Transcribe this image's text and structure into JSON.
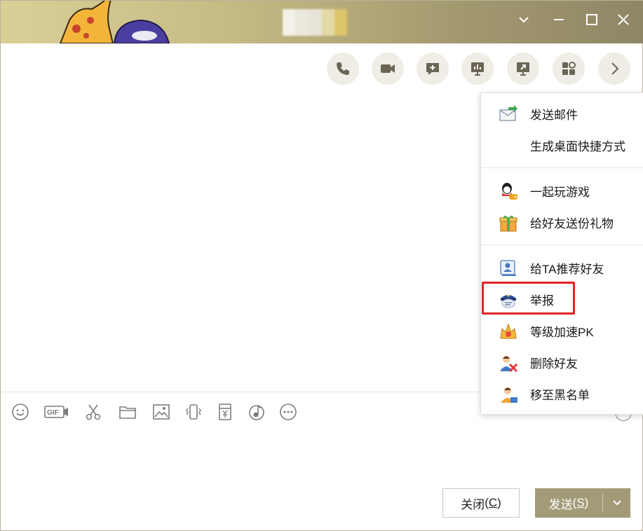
{
  "window": {
    "controls": [
      "chevron-down-icon",
      "minimize-icon",
      "maximize-icon",
      "close-icon"
    ]
  },
  "toolbar": {
    "buttons": [
      "phone-icon",
      "video-call-icon",
      "chat-bubble-plus-icon",
      "whiteboard-icon",
      "screen-share-icon",
      "apps-icon",
      "chevron-right-icon"
    ]
  },
  "input_toolbar": {
    "buttons": [
      "emoji-icon",
      "gif-icon",
      "scissors-icon",
      "folder-icon",
      "image-icon",
      "shake-icon",
      "red-packet-icon",
      "music-icon",
      "more-icon"
    ],
    "gif_text": "GIF"
  },
  "menu": {
    "items": [
      {
        "label": "发送邮件",
        "icon": "mail-icon"
      },
      {
        "label": "生成桌面快捷方式",
        "icon": ""
      },
      {
        "label": "一起玩游戏",
        "icon": "game-icon"
      },
      {
        "label": "给好友送份礼物",
        "icon": "gift-icon"
      },
      {
        "label": "给TA推荐好友",
        "icon": "recommend-contact-icon"
      },
      {
        "label": "举报",
        "icon": "police-report-icon"
      },
      {
        "label": "等级加速PK",
        "icon": "crown-icon"
      },
      {
        "label": "删除好友",
        "icon": "delete-friend-icon"
      },
      {
        "label": "移至黑名单",
        "icon": "blacklist-icon"
      }
    ],
    "highlighted_index": 5,
    "highlight_color": "#e02424"
  },
  "footer": {
    "close_label": "关闭",
    "close_key_open": "(",
    "close_key": "C",
    "close_key_close": ")",
    "send_label": "发送",
    "send_key_open": "(",
    "send_key": "S",
    "send_key_close": ")"
  },
  "colors": {
    "accent": "#a39b78",
    "titlebar": "#c6bb84"
  }
}
